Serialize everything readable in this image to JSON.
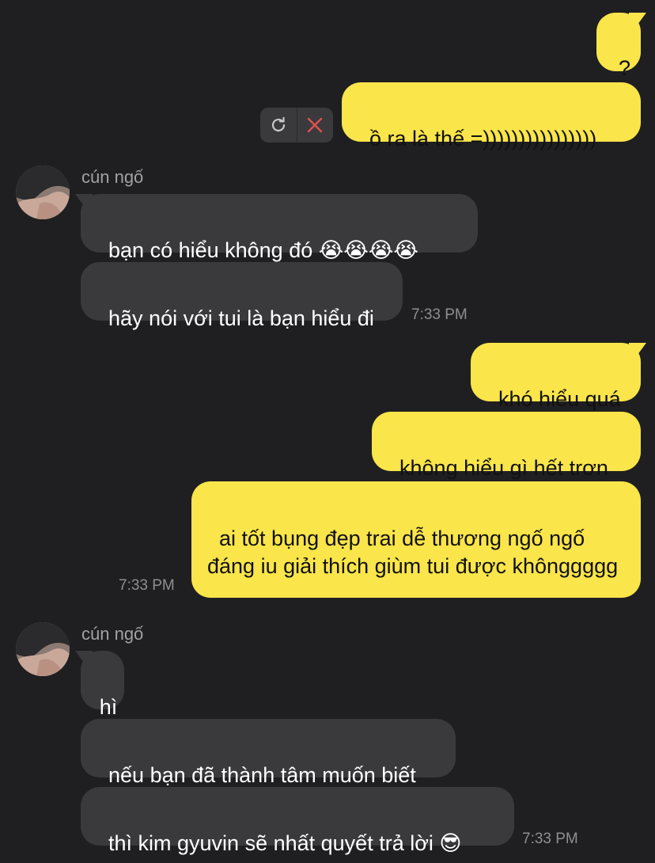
{
  "messages": [
    {
      "text": "?"
    },
    {
      "text": "ồ ra là thế =))))))))))))))))"
    },
    {
      "text": "bạn có hiểu không đó 😭😭😭😭"
    },
    {
      "text": "hãy nói với tui là bạn hiểu đi"
    },
    {
      "text": "khó hiểu quá"
    },
    {
      "text": "không hiểu gì hết trơn"
    },
    {
      "text": "ai tốt bụng đẹp trai dễ thương ngố ngố đáng iu giải thích giùm tui được khônggggg"
    },
    {
      "text": "hì"
    },
    {
      "text": "nếu bạn đã thành tâm muốn biết"
    },
    {
      "text": "thì kim gyuvin sẽ nhất quyết trả lời 😎"
    }
  ],
  "timestamps": [
    "7:33 PM",
    "7:33 PM",
    "7:33 PM"
  ],
  "sender_names": [
    "cún ngố",
    "cún ngố"
  ],
  "failed_actions": {
    "retry_icon": "refresh-icon",
    "delete_icon": "close-icon"
  },
  "colors": {
    "background": "#1f1f21",
    "outgoing_bubble": "#fae54a",
    "incoming_bubble": "#3a3a3c",
    "timestamp": "#8e8e93",
    "delete_x": "#e0504f"
  }
}
